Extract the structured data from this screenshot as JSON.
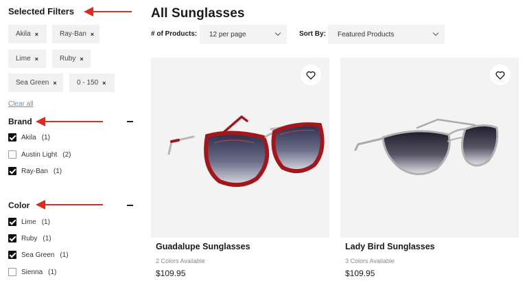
{
  "sidebar": {
    "selected_filters_title": "Selected Filters",
    "chips": [
      "Akila",
      "Ray-Ban",
      "Lime",
      "Ruby",
      "Sea Green",
      "0 - 150"
    ],
    "remove_glyph": "×",
    "clear_all": "Clear all",
    "brand": {
      "title": "Brand",
      "options": [
        {
          "label": "Akila",
          "count": "(1)",
          "checked": true
        },
        {
          "label": "Austin Light",
          "count": "(2)",
          "checked": false
        },
        {
          "label": "Ray-Ban",
          "count": "(1)",
          "checked": true
        }
      ]
    },
    "color": {
      "title": "Color",
      "options": [
        {
          "label": "Lime",
          "count": "(1)",
          "checked": true
        },
        {
          "label": "Ruby",
          "count": "(1)",
          "checked": true
        },
        {
          "label": "Sea Green",
          "count": "(1)",
          "checked": true
        },
        {
          "label": "Sienna",
          "count": "(1)",
          "checked": false
        }
      ]
    }
  },
  "main": {
    "title": "All Sunglasses",
    "products_label": "# of Products:",
    "per_page_value": "12 per page",
    "sort_label": "Sort By:",
    "sort_value": "Featured Products",
    "products": [
      {
        "name": "Guadalupe Sunglasses",
        "colors": "2 Colors Available",
        "price": "$109.95"
      },
      {
        "name": "Lady Bird Sunglasses",
        "colors": "3 Colors Available",
        "price": "$109.95"
      }
    ]
  },
  "colors": {
    "annotation_arrow": "#e8261c",
    "chip_bg": "#f1f1f1",
    "card_bg": "#f3f3f3",
    "frame_red": "#a3171c"
  },
  "icons": [
    "remove-x-icon",
    "minus-icon",
    "checkmark-icon",
    "chevron-down-icon",
    "heart-icon",
    "annotation-arrow"
  ]
}
